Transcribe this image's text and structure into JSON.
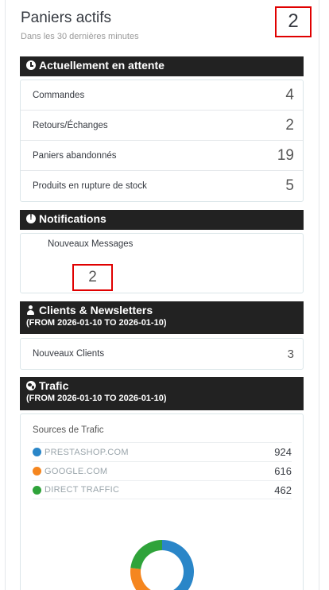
{
  "header": {
    "title": "Paniers actifs",
    "subtitle": "Dans les 30 dernières minutes",
    "count": "2"
  },
  "pending": {
    "title": "Actuellement en attente",
    "rows": [
      {
        "label": "Commandes",
        "value": "4"
      },
      {
        "label": "Retours/Échanges",
        "value": "2"
      },
      {
        "label": "Paniers abandonnés",
        "value": "19"
      },
      {
        "label": "Produits en rupture de stock",
        "value": "5"
      }
    ]
  },
  "notifications": {
    "title": "Notifications",
    "label": "Nouveaux Messages",
    "count": "2"
  },
  "clients": {
    "title": "Clients & Newsletters",
    "range": "(FROM 2026-01-10 TO 2026-01-10)",
    "rows": [
      {
        "label": "Nouveaux Clients",
        "value": "3"
      }
    ]
  },
  "traffic": {
    "title": "Trafic",
    "range": "(FROM 2026-01-10 TO 2026-01-10)",
    "sources_title": "Sources de Trafic",
    "sources": [
      {
        "name": "PRESTASHOP.COM",
        "value": "924",
        "color": "#2a86c8"
      },
      {
        "name": "GOOGLE.COM",
        "value": "616",
        "color": "#f5861f"
      },
      {
        "name": "DIRECT TRAFFIC",
        "value": "462",
        "color": "#2fa33a"
      }
    ]
  },
  "chart_data": {
    "type": "pie",
    "categories": [
      "PRESTASHOP.COM",
      "GOOGLE.COM",
      "DIRECT TRAFFIC"
    ],
    "values": [
      924,
      616,
      462
    ],
    "colors": [
      "#2a86c8",
      "#f5861f",
      "#2fa33a"
    ],
    "title": ""
  }
}
